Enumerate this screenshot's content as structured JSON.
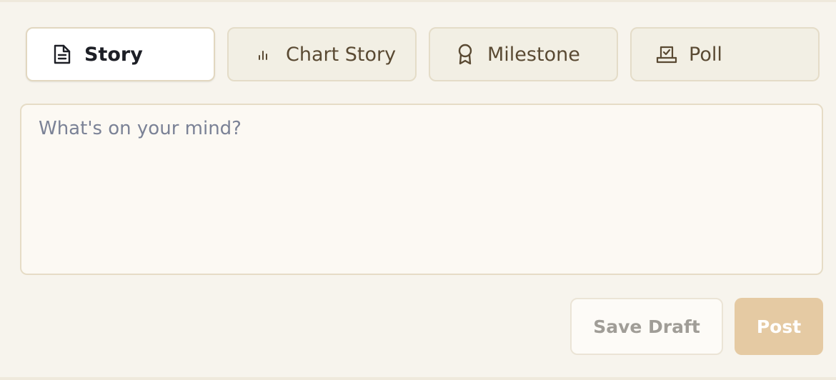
{
  "tabs": [
    {
      "label": "Story",
      "icon": "document-icon",
      "active": true
    },
    {
      "label": "Chart Story",
      "icon": "bar-chart-icon",
      "active": false
    },
    {
      "label": "Milestone",
      "icon": "award-ribbon-icon",
      "active": false
    },
    {
      "label": "Poll",
      "icon": "ballot-box-icon",
      "active": false
    }
  ],
  "composer": {
    "placeholder": "What's on your mind?",
    "value": ""
  },
  "actions": {
    "save_draft_label": "Save Draft",
    "post_label": "Post"
  },
  "colors": {
    "background": "#f7f4ed",
    "tab_inactive_bg": "#f2efe4",
    "tab_active_bg": "#ffffff",
    "tab_text": "#5a4a33",
    "active_text": "#1d1f26",
    "placeholder": "#7b8296",
    "post_button_bg": "#e5caa3"
  }
}
